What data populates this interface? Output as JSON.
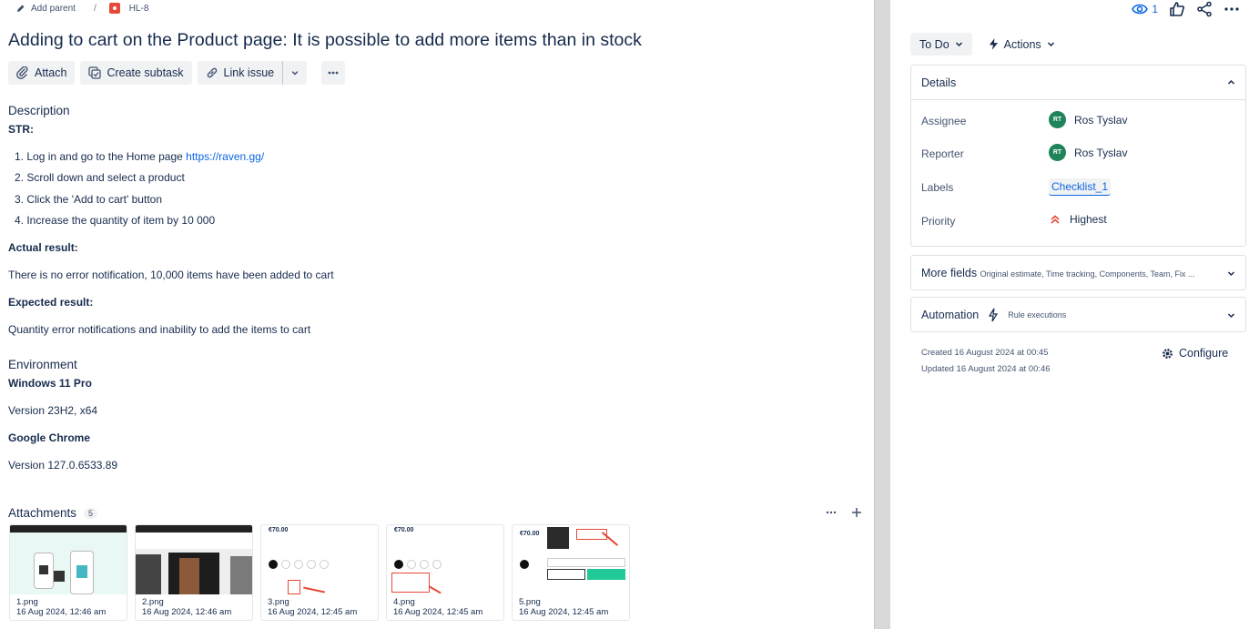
{
  "breadcrumb": {
    "add_parent": "Add parent",
    "separator": "/",
    "issue_key": "HL-8"
  },
  "issue": {
    "title": "Adding to cart on the Product page: It is possible to add more items than in stock"
  },
  "toolbar": {
    "attach": "Attach",
    "create_subtask": "Create subtask",
    "link_issue": "Link issue"
  },
  "description": {
    "heading": "Description",
    "str_label": "STR:",
    "steps": [
      "1. Log in and go to the Home page ",
      "2. Scroll down and select a product",
      "3. Click the 'Add to cart' button",
      "4. Increase the quantity of item by 10 000"
    ],
    "link": "https://raven.gg/",
    "actual_label": "Actual result:",
    "actual_text": "There is no error notification, 10,000 items have been added to cart",
    "expected_label": "Expected result:",
    "expected_text": "Quantity error notifications and inability to add the items to cart"
  },
  "environment": {
    "heading": "Environment",
    "os_label": "Windows 11 Pro",
    "os_version": "Version 23H2, x64",
    "browser_label": "Google Chrome",
    "browser_version": "Version 127.0.6533.89"
  },
  "attachments": {
    "heading": "Attachments",
    "count": "5",
    "items": [
      {
        "name": "1.png",
        "date": "16 Aug 2024, 12:46 am"
      },
      {
        "name": "2.png",
        "date": "16 Aug 2024, 12:46 am"
      },
      {
        "name": "3.png",
        "date": "16 Aug 2024, 12:45 am"
      },
      {
        "name": "4.png",
        "date": "16 Aug 2024, 12:45 am"
      },
      {
        "name": "5.png",
        "date": "16 Aug 2024, 12:45 am"
      }
    ],
    "thumb_text": {
      "price1": "€70.00",
      "price2": "€70.00",
      "price3": "€70.00"
    }
  },
  "side": {
    "watchers": "1",
    "status": "To Do",
    "actions": "Actions",
    "details": {
      "heading": "Details",
      "assignee_label": "Assignee",
      "assignee_initials": "RT",
      "assignee_name": "Ros Tyslav",
      "reporter_label": "Reporter",
      "reporter_initials": "RT",
      "reporter_name": "Ros Tyslav",
      "labels_label": "Labels",
      "label_value": "Checklist_1",
      "priority_label": "Priority",
      "priority_value": "Highest"
    },
    "more_fields": {
      "heading": "More fields",
      "hint": "Original estimate, Time tracking, Components, Team, Fix ..."
    },
    "automation": {
      "heading": "Automation",
      "hint": "Rule executions"
    },
    "created": "Created 16 August 2024 at 00:45",
    "updated": "Updated 16 August 2024 at 00:46",
    "configure": "Configure"
  },
  "colors": {
    "link": "#0c66e4",
    "bug": "#e5493a",
    "avatar": "#1f845a",
    "priority": "#e5493a"
  }
}
